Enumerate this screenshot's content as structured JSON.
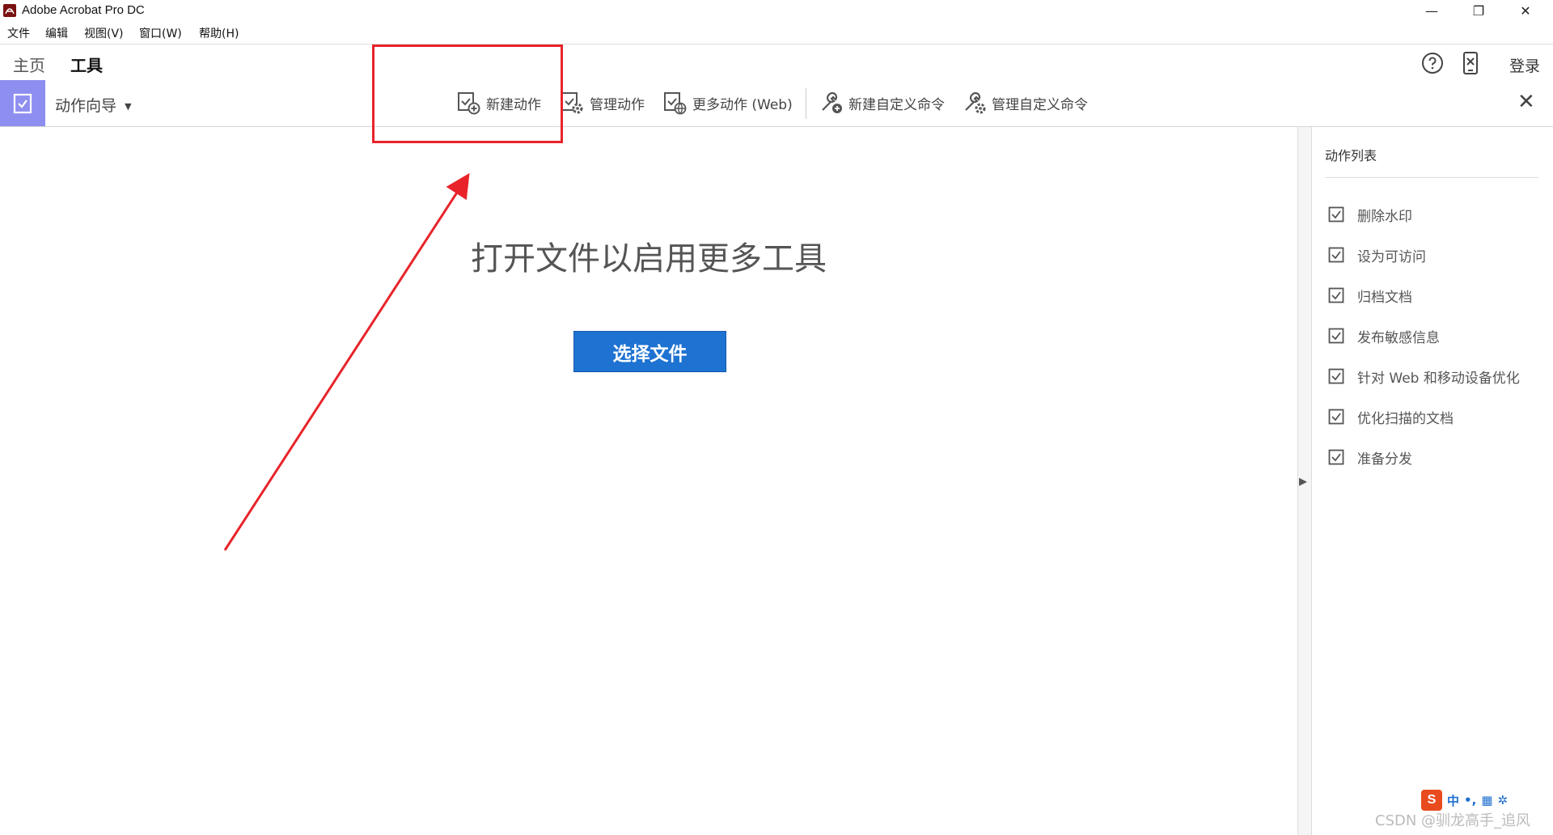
{
  "window": {
    "title": "Adobe Acrobat Pro DC",
    "controls": {
      "minimize": "—",
      "restore": "❐",
      "close": "✕"
    }
  },
  "menu": [
    "文件",
    "编辑",
    "视图(V)",
    "窗口(W)",
    "帮助(H)"
  ],
  "tabs": [
    {
      "label": "主页",
      "active": false
    },
    {
      "label": "工具",
      "active": true
    }
  ],
  "header_right": {
    "help_icon": "help-icon",
    "mobile_icon": "mobile-link-icon",
    "login_label": "登录"
  },
  "toolbar": {
    "tool_name": "动作向导",
    "buttons": [
      {
        "label": "新建动作",
        "icon": "new-action-icon"
      },
      {
        "label": "管理动作",
        "icon": "manage-actions-icon"
      },
      {
        "label": "更多动作 (Web)",
        "icon": "more-actions-web-icon"
      },
      {
        "label": "新建自定义命令",
        "icon": "new-custom-command-icon"
      },
      {
        "label": "管理自定义命令",
        "icon": "manage-custom-command-icon"
      }
    ],
    "close": "✕"
  },
  "main": {
    "message": "打开文件以启用更多工具",
    "select_button": "选择文件"
  },
  "right_panel": {
    "title": "动作列表",
    "items": [
      "删除水印",
      "设为可访问",
      "归档文档",
      "发布敏感信息",
      "针对 Web 和移动设备优化",
      "优化扫描的文档",
      "准备分发"
    ]
  },
  "watermark": "CSDN @驯龙高手_追风",
  "ime": {
    "mode": "中",
    "punct": "•,",
    "colors": {
      "brand": "#e84c1e",
      "accent": "#1e6fd0"
    }
  },
  "colors": {
    "primary_button": "#1e73d2",
    "tool_icon_bg": "#8e8ef0",
    "annotation": "#e8242a"
  }
}
